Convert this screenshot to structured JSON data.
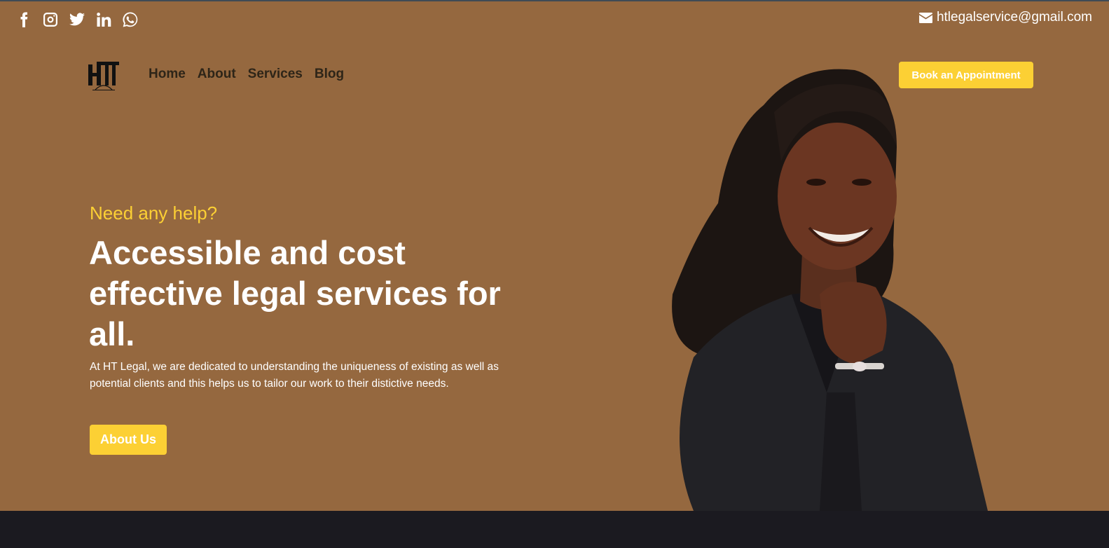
{
  "colors": {
    "hero_bg": "#95683f",
    "accent": "#fcd034",
    "footer_bg": "#1b1a20",
    "nav_text": "#2e2518"
  },
  "social": [
    "facebook-icon",
    "instagram-icon",
    "twitter-icon",
    "linkedin-icon",
    "whatsapp-icon"
  ],
  "contact": {
    "email": "htlegalservice@gmail.com",
    "icon": "envelope-icon"
  },
  "nav": {
    "items": [
      "Home",
      "About",
      "Services",
      "Blog"
    ]
  },
  "header": {
    "cta_label": "Book an Appointment"
  },
  "hero": {
    "eyebrow": "Need any help?",
    "headline": "Accessible and cost effective legal services for all.",
    "description": "At HT Legal, we are dedicated to understanding the uniqueness of existing as well as potential clients and this helps us to tailor our work to their distictive needs.",
    "button_label": "About Us"
  }
}
